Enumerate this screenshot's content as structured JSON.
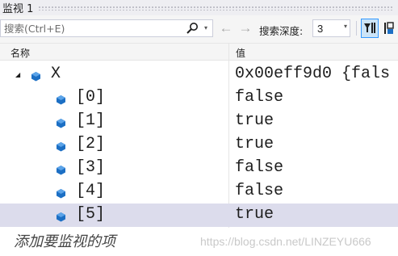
{
  "window": {
    "title": "监视 1"
  },
  "toolbar": {
    "search_placeholder": "搜索(Ctrl+E)",
    "depth_label": "搜索深度:",
    "depth_value": "3"
  },
  "columns": {
    "name": "名称",
    "value": "值"
  },
  "rows": [
    {
      "name": "X",
      "value": "0x00eff9d0 {fals",
      "expanded": true,
      "level": 0
    },
    {
      "name": "[0]",
      "value": "false",
      "level": 1
    },
    {
      "name": "[1]",
      "value": "true",
      "level": 1
    },
    {
      "name": "[2]",
      "value": "true",
      "level": 1
    },
    {
      "name": "[3]",
      "value": "false",
      "level": 1
    },
    {
      "name": "[4]",
      "value": "false",
      "level": 1
    },
    {
      "name": "[5]",
      "value": "true",
      "level": 1,
      "selected": true
    }
  ],
  "add_watch_prompt": "添加要监视的项",
  "watermark": "https://blog.csdn.net/LINZEYU666",
  "colors": {
    "accent": "#3399ff",
    "selected_row": "#dcdcec",
    "object_icon": "#1c6fc4"
  },
  "icons": [
    "search-icon",
    "chevron-down-icon",
    "back-arrow-icon",
    "forward-arrow-icon",
    "filter-icon",
    "hex-display-icon",
    "object-icon",
    "expander-icon"
  ]
}
